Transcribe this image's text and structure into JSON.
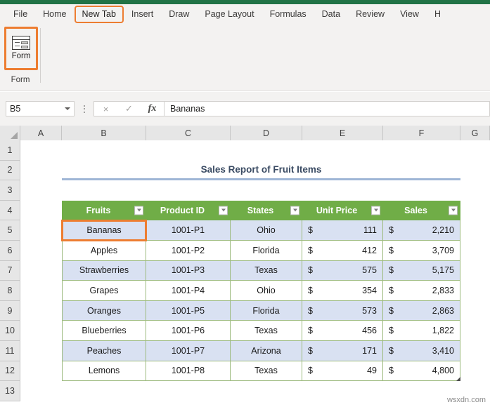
{
  "ribbon": {
    "tabs": [
      {
        "label": "File",
        "highlighted": false
      },
      {
        "label": "Home",
        "highlighted": false
      },
      {
        "label": "New Tab",
        "highlighted": true
      },
      {
        "label": "Insert",
        "highlighted": false
      },
      {
        "label": "Draw",
        "highlighted": false
      },
      {
        "label": "Page Layout",
        "highlighted": false
      },
      {
        "label": "Formulas",
        "highlighted": false
      },
      {
        "label": "Data",
        "highlighted": false
      },
      {
        "label": "Review",
        "highlighted": false
      },
      {
        "label": "View",
        "highlighted": false
      },
      {
        "label": "H",
        "highlighted": false
      }
    ],
    "form_button_label": "Form",
    "group_label": "Form"
  },
  "formula_bar": {
    "name_box_value": "B5",
    "cancel_icon": "×",
    "confirm_icon": "✓",
    "function_icon": "fx",
    "value": "Bananas"
  },
  "grid": {
    "column_headers": [
      "A",
      "B",
      "C",
      "D",
      "E",
      "F",
      "G"
    ],
    "row_headers": [
      "1",
      "2",
      "3",
      "4",
      "5",
      "6",
      "7",
      "8",
      "9",
      "10",
      "11",
      "12",
      "13"
    ]
  },
  "sheet": {
    "report_title": "Sales Report of Fruit Items",
    "selected_cell": "B5",
    "table": {
      "headers": [
        "Fruits",
        "Product ID",
        "States",
        "Unit Price",
        "Sales"
      ],
      "currency_symbol": "$",
      "rows": [
        {
          "fruit": "Bananas",
          "product_id": "1001-P1",
          "state": "Ohio",
          "unit_price": "111",
          "sales": "2,210"
        },
        {
          "fruit": "Apples",
          "product_id": "1001-P2",
          "state": "Florida",
          "unit_price": "412",
          "sales": "3,709"
        },
        {
          "fruit": "Strawberries",
          "product_id": "1001-P3",
          "state": "Texas",
          "unit_price": "575",
          "sales": "5,175"
        },
        {
          "fruit": "Grapes",
          "product_id": "1001-P4",
          "state": "Ohio",
          "unit_price": "354",
          "sales": "2,833"
        },
        {
          "fruit": "Oranges",
          "product_id": "1001-P5",
          "state": "Florida",
          "unit_price": "573",
          "sales": "2,863"
        },
        {
          "fruit": "Blueberries",
          "product_id": "1001-P6",
          "state": "Texas",
          "unit_price": "456",
          "sales": "1,822"
        },
        {
          "fruit": "Peaches",
          "product_id": "1001-P7",
          "state": "Arizona",
          "unit_price": "171",
          "sales": "3,410"
        },
        {
          "fruit": "Lemons",
          "product_id": "1001-P8",
          "state": "Texas",
          "unit_price": "49",
          "sales": "4,800"
        }
      ]
    }
  },
  "watermark": "wsxdn.com",
  "colors": {
    "excel_green": "#217346",
    "table_header_green": "#70AD47",
    "band_fill": "#D9E1F2",
    "highlight_orange": "#ED7D31",
    "title_text": "#3a4b63",
    "title_rule": "#9fb6d6"
  }
}
